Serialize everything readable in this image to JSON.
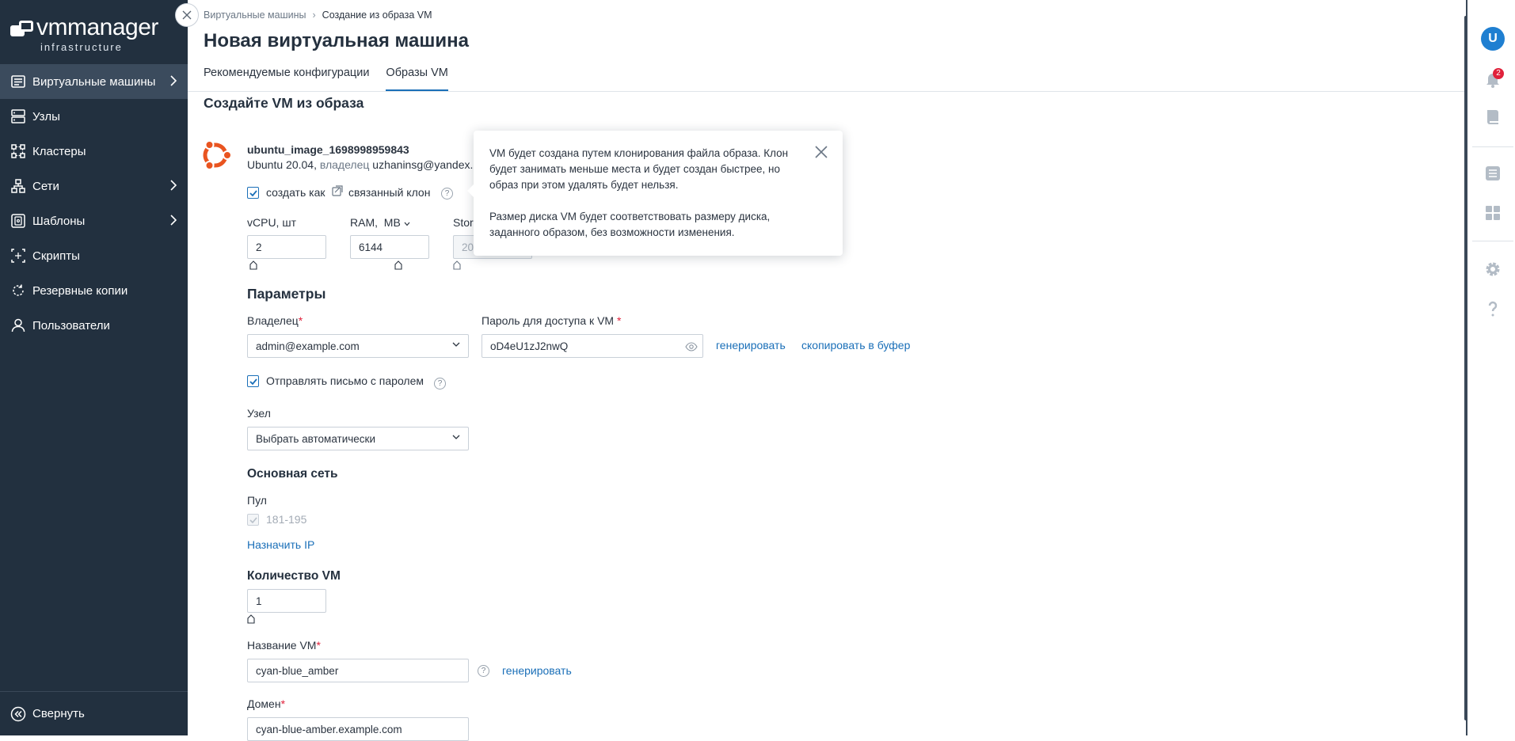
{
  "app": {
    "brand": "vmmanager",
    "brand_sub": "infrastructure"
  },
  "sidebar": {
    "items": [
      {
        "label": "Виртуальные машины",
        "icon": "vm-icon",
        "active": true,
        "has_children": true
      },
      {
        "label": "Узлы",
        "icon": "server-icon",
        "has_children": false
      },
      {
        "label": "Кластеры",
        "icon": "cluster-icon",
        "has_children": false
      },
      {
        "label": "Сети",
        "icon": "network-icon",
        "has_children": true
      },
      {
        "label": "Шаблоны",
        "icon": "template-icon",
        "has_children": true
      },
      {
        "label": "Скрипты",
        "icon": "script-icon",
        "has_children": false
      },
      {
        "label": "Резервные копии",
        "icon": "backup-icon",
        "has_children": false
      },
      {
        "label": "Пользователи",
        "icon": "user-icon",
        "has_children": false
      }
    ],
    "collapse_label": "Свернуть"
  },
  "breadcrumb": {
    "parent": "Виртуальные машины",
    "current": "Создание из образа VM"
  },
  "page_title": "Новая виртуальная машина",
  "tabs": [
    {
      "label": "Рекомендуемые конфигурации",
      "active": false
    },
    {
      "label": "Образы VM",
      "active": true
    }
  ],
  "section_title": "Создайте VM из образа",
  "image": {
    "name": "ubuntu_image_1698998959843",
    "os": "Ubuntu 20.04,",
    "owner_label": "владелец",
    "owner": "uzhaninsg@yandex.",
    "create_as_label": "создать как",
    "linked_clone_label": "связанный клон",
    "create_as_checked": true
  },
  "resources": {
    "vcpu_label": "vCPU, шт",
    "vcpu_value": "2",
    "ram_label": "RAM,",
    "ram_unit": "MB",
    "ram_value": "6144",
    "storage_label": "Stor",
    "storage_value": "20"
  },
  "tooltip": {
    "paragraph1": "VM будет создана путем клонирования файла образа. Клон будет занимать меньше места и будет создан быстрее, но образ при этом удалять будет нельзя.",
    "paragraph2": "Размер диска VM будет соответствовать размеру диска, заданного образом, без возможности изменения."
  },
  "params": {
    "title": "Параметры",
    "owner_label": "Владелец",
    "owner_value": "admin@example.com",
    "password_label": "Пароль для доступа к VM",
    "password_value": "oD4eU1zJ2nwQ",
    "generate_label": "генерировать",
    "copy_label": "скопировать в буфер",
    "send_email_label": "Отправлять письмо с паролем",
    "send_email_checked": true,
    "node_label": "Узел",
    "node_value": "Выбрать автоматически"
  },
  "network": {
    "title": "Основная сеть",
    "pool_label": "Пул",
    "pool_value": "181-195",
    "assign_ip_label": "Назначить IP"
  },
  "vm_count": {
    "title": "Количество VM",
    "value": "1"
  },
  "vm_name": {
    "label": "Название VM",
    "value": "cyan-blue_amber",
    "generate_label": "генерировать"
  },
  "domain": {
    "label": "Домен",
    "value": "cyan-blue-amber.example.com"
  },
  "rail": {
    "avatar_letter": "U",
    "notifications_count": "2"
  },
  "colors": {
    "sidebar_bg": "#22303f",
    "sidebar_active": "#3b4b5d",
    "accent": "#1a6fb8",
    "required": "#e0213b",
    "ubuntu_orange": "#e95420"
  }
}
